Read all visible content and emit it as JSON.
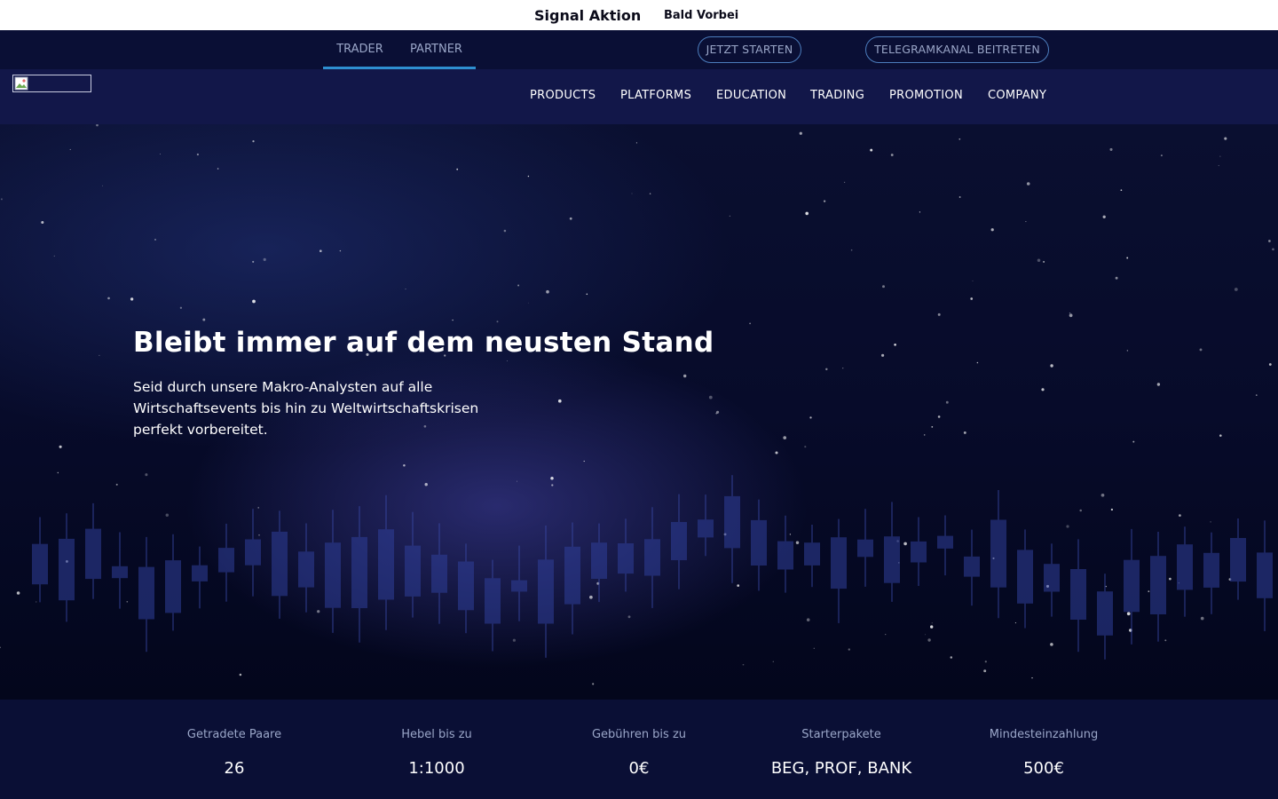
{
  "promo": {
    "title": "Signal Aktion",
    "status": "Bald Vorbei"
  },
  "topnav": {
    "tabs": [
      {
        "label": "TRADER"
      },
      {
        "label": "PARTNER"
      }
    ],
    "buttons": {
      "start": "JETZT STARTEN",
      "telegram": "TELEGRAMKANAL BEITRETEN"
    }
  },
  "mainnav": {
    "items": [
      {
        "label": "PRODUCTS"
      },
      {
        "label": "PLATFORMS"
      },
      {
        "label": "EDUCATION"
      },
      {
        "label": "TRADING"
      },
      {
        "label": "PROMOTION"
      },
      {
        "label": "COMPANY"
      }
    ]
  },
  "hero": {
    "title": "Bleibt immer auf dem neusten Stand",
    "text": "Seid durch unsere Makro-Analysten auf alle Wirtschaftsevents bis hin zu Weltwirtschaftskrisen perfekt vorbereitet."
  },
  "stats": [
    {
      "label": "Getradete Paare",
      "value": "26"
    },
    {
      "label": "Hebel bis zu",
      "value": "1:1000"
    },
    {
      "label": "Gebühren bis zu",
      "value": "0€"
    },
    {
      "label": "Starterpakete",
      "value": "BEG, PROF, BANK"
    },
    {
      "label": "Mindesteinzahlung",
      "value": "500€"
    }
  ],
  "colors": {
    "accent": "#2e8fd0",
    "navbg": "#121749",
    "topbg": "#0a0f35"
  }
}
